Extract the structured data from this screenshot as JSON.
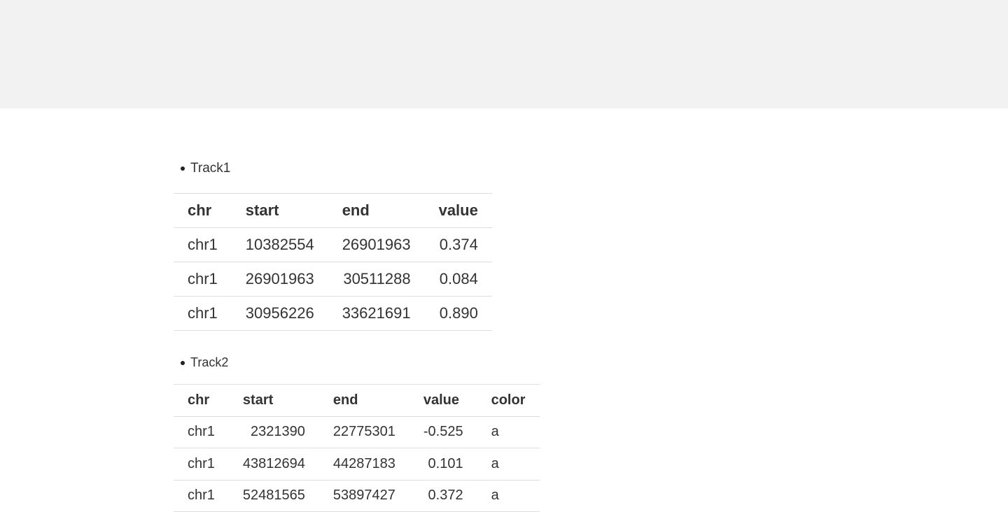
{
  "tracks": [
    {
      "title": "Track1",
      "headers": [
        "chr",
        "start",
        "end",
        "value"
      ],
      "rows": [
        [
          "chr1",
          "10382554",
          "26901963",
          "0.374"
        ],
        [
          "chr1",
          "26901963",
          "30511288",
          "0.084"
        ],
        [
          "chr1",
          "30956226",
          "33621691",
          "0.890"
        ]
      ]
    },
    {
      "title": "Track2",
      "headers": [
        "chr",
        "start",
        "end",
        "value",
        "color"
      ],
      "rows": [
        [
          "chr1",
          "2321390",
          "22775301",
          "-0.525",
          "a"
        ],
        [
          "chr1",
          "43812694",
          "44287183",
          "0.101",
          "a"
        ],
        [
          "chr1",
          "52481565",
          "53897427",
          "0.372",
          "a"
        ]
      ]
    }
  ]
}
